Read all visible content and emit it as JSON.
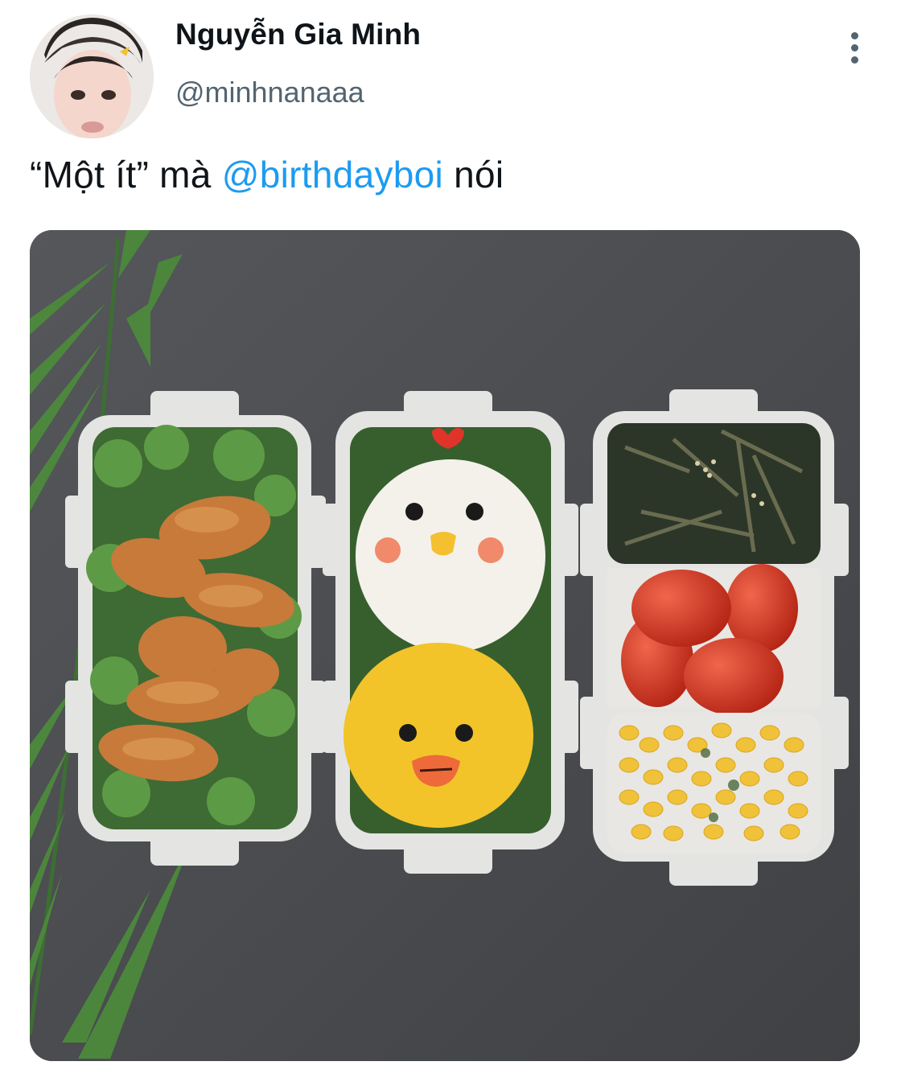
{
  "author": {
    "display_name": "Nguyễn Gia Minh",
    "handle": "@minhnanaaa"
  },
  "tweet": {
    "text_prefix": "“Một ít” mà ",
    "mention": "@birthdayboi",
    "text_suffix": " nói"
  },
  "media": {
    "alt": "Bento lunch boxes with fried chicken salad, chick-shaped rice balls, seaweed, tomatoes and corn"
  },
  "icons": {
    "more": "more-vertical-icon"
  },
  "colors": {
    "text_primary": "#0f1419",
    "text_secondary": "#536471",
    "link": "#1d9bf0"
  }
}
